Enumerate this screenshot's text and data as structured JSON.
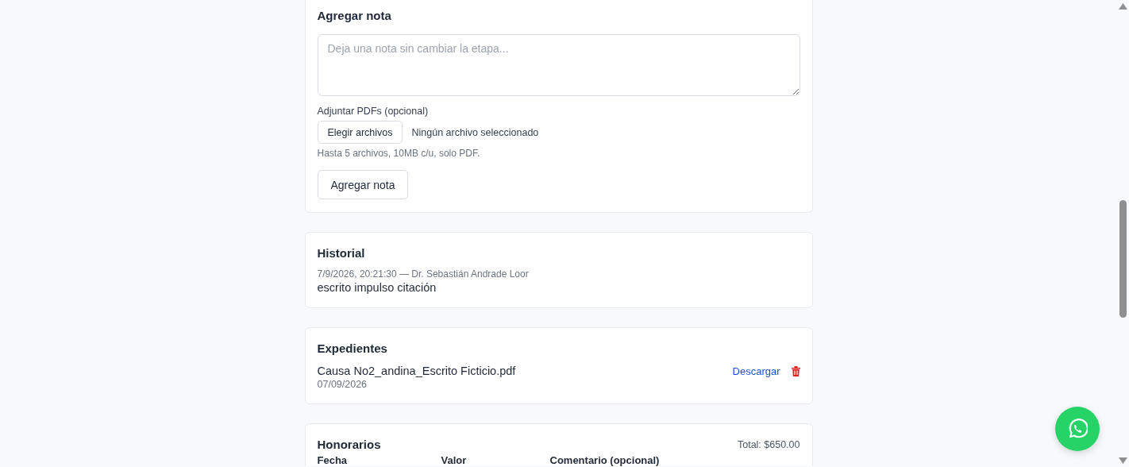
{
  "add_note": {
    "title": "Agregar nota",
    "note_field": {
      "placeholder": "Deja una nota sin cambiar la etapa..."
    },
    "attach_label": "Adjuntar PDFs (opcional)",
    "file_button": "Elegir archivos",
    "file_status": "Ningún archivo seleccionado",
    "hint": "Hasta 5 archivos, 10MB c/u, solo PDF.",
    "submit_button": "Agregar nota"
  },
  "history": {
    "title": "Historial",
    "entries": [
      {
        "meta": "7/9/2026, 20:21:30 — Dr. Sebastián Andrade Loor",
        "text": "escrito impulso citación"
      }
    ]
  },
  "files": {
    "title": "Expedientes",
    "items": [
      {
        "name": "Causa No2_andina_Escrito Ficticio.pdf",
        "date": "07/09/2026",
        "download": "Descargar"
      }
    ]
  },
  "fees": {
    "title": "Honorarios",
    "total": "Total: $650.00",
    "columns": [
      "Fecha",
      "Valor",
      "Comentario (opcional)"
    ]
  }
}
